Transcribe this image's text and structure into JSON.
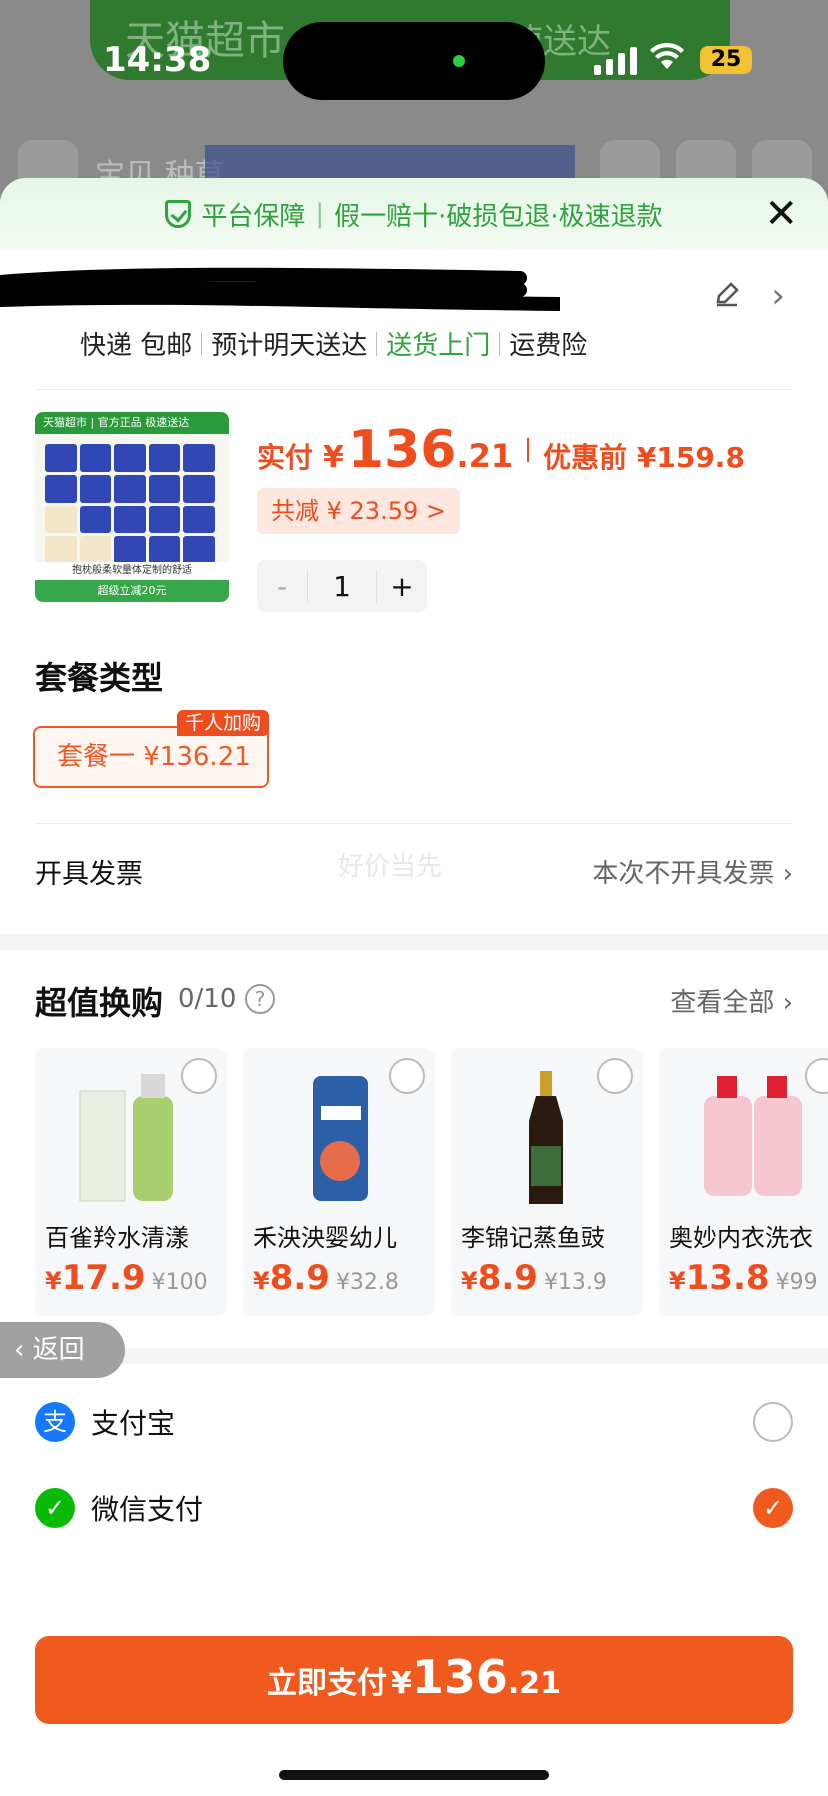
{
  "status_bar": {
    "time": "14:38",
    "battery": "25"
  },
  "background": {
    "banner_left": "天猫超市",
    "banner_right": "极速送达",
    "nav_text": "宝贝  种草"
  },
  "guarantee": {
    "title": "平台保障",
    "items": "假一赔十·破损包退·极速退款"
  },
  "address": {
    "delivery": "快递 包邮",
    "eta": "预计明天送达",
    "door": "送货上门",
    "insurance": "运费险"
  },
  "product": {
    "image_top": "天猫超市 | 官方正品 极速送达",
    "image_caption": "抱枕般柔软量体定制的舒适",
    "image_promo": "超级立减20元",
    "price_label": "实付",
    "currency": "¥",
    "price_int": "136",
    "price_dec": ".21",
    "original": "优惠前 ¥159.8",
    "discount": "共减 ¥ 23.59 >",
    "quantity": "1",
    "minus": "-",
    "plus": "+"
  },
  "package": {
    "title": "套餐类型",
    "option_label": "套餐一  ¥136.21",
    "option_tag": "千人加购"
  },
  "invoice": {
    "label": "开具发票",
    "value": "本次不开具发票"
  },
  "watermark": "好价当先",
  "deals": {
    "title": "超值换购",
    "count": "0/10",
    "help": "?",
    "view_all": "查看全部",
    "items": [
      {
        "name": "百雀羚水清漾",
        "price": "17.9",
        "orig": "¥100"
      },
      {
        "name": "禾泱泱婴幼儿",
        "price": "8.9",
        "orig": "¥32.8"
      },
      {
        "name": "李锦记蒸鱼豉",
        "price": "8.9",
        "orig": "¥13.9"
      },
      {
        "name": "奥妙内衣洗衣",
        "price": "13.8",
        "orig": "¥99"
      }
    ]
  },
  "payment": {
    "alipay": {
      "label": "支付宝",
      "icon": "支"
    },
    "wechat": {
      "label": "微信支付",
      "icon": "✓"
    }
  },
  "back_label": "返回",
  "pay_button": {
    "text": "立即支付",
    "currency": "¥",
    "int": "136",
    "dec": ".21"
  },
  "colors": {
    "accent": "#f05a1e",
    "green": "#2fa33c",
    "alipay": "#1677ff",
    "wechat": "#09bb07"
  }
}
